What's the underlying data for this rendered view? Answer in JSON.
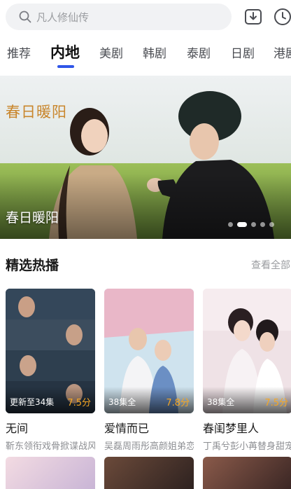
{
  "search": {
    "placeholder": "凡人修仙传"
  },
  "tabs": [
    {
      "label": "推荐",
      "active": false
    },
    {
      "label": "内地",
      "active": true
    },
    {
      "label": "美剧",
      "active": false
    },
    {
      "label": "韩剧",
      "active": false
    },
    {
      "label": "泰剧",
      "active": false
    },
    {
      "label": "日剧",
      "active": false
    },
    {
      "label": "港剧",
      "active": false
    }
  ],
  "banner": {
    "title": "春日暖阳",
    "logo_text": "春日暖阳",
    "slide_count": 5,
    "active_slide": 2
  },
  "section": {
    "title": "精选热播",
    "more_label": "查看全部"
  },
  "cards": [
    {
      "status": "更新至34集",
      "score": "7.5分",
      "title": "无间",
      "subtitle": "靳东领衔戏骨掀谍战风云"
    },
    {
      "status": "38集全",
      "score": "7.8分",
      "title": "爱情而已",
      "subtitle": "吴磊周雨彤高颜姐弟恋"
    },
    {
      "status": "38集全",
      "score": "7.5分",
      "title": "春闺梦里人",
      "subtitle": "丁禹兮彭小苒替身甜宠"
    }
  ],
  "colors": {
    "accent": "#2f56e8",
    "score": "#f5a623"
  },
  "icons": [
    "search-icon",
    "download-icon",
    "history-icon"
  ]
}
